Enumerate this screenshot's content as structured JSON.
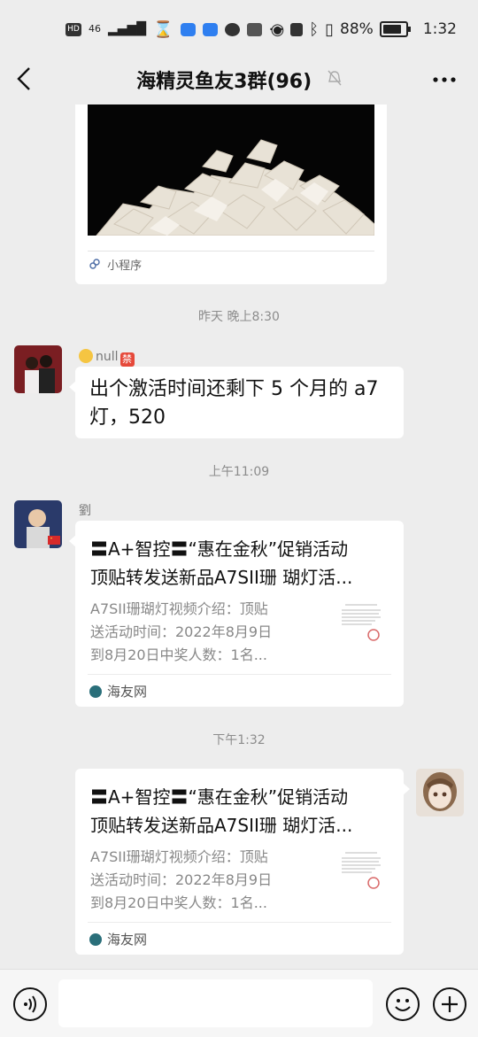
{
  "status_bar": {
    "left_tags": [
      "HD",
      "46"
    ],
    "battery_pct": "88%",
    "time": "1:32"
  },
  "nav": {
    "back_label": "<",
    "title": "海精灵鱼友3群(96)",
    "more_label": "•••"
  },
  "messages": {
    "mini_program": {
      "label": "小程序"
    },
    "time_1": "昨天 晚上8:30",
    "msg_1": {
      "sender": "null",
      "sender_badge": "禁",
      "text_line1": "出个激活时间还剩下 5 个月的 a7",
      "text_line2": "灯，520"
    },
    "time_2": "上午11:09",
    "msg_2": {
      "sender": "劉",
      "title_line1": "〓A+智控〓“惠在金秋”促销活动",
      "title_line2": "顶贴转发送新品A7SII珊 瑚灯活...",
      "desc_line1": "A7SII珊瑚灯视频介绍：顶贴",
      "desc_line2": "送活动时间：2022年8月9日",
      "desc_line3": "到8月20日中奖人数：1名...",
      "source": "海友网"
    },
    "time_3": "下午1:32",
    "msg_3": {
      "title_line1": "〓A+智控〓“惠在金秋”促销活动",
      "title_line2": "顶贴转发送新品A7SII珊 瑚灯活...",
      "desc_line1": "A7SII珊瑚灯视频介绍：顶贴",
      "desc_line2": "送活动时间：2022年8月9日",
      "desc_line3": "到8月20日中奖人数：1名...",
      "source": "海友网"
    }
  },
  "input_bar": {
    "voice_icon": "voice-icon",
    "emoji_icon": "emoji-icon",
    "plus_icon": "plus-icon"
  },
  "colors": {
    "background": "#ededed",
    "bubble": "#ffffff",
    "link_accent": "#4e6ea6"
  }
}
